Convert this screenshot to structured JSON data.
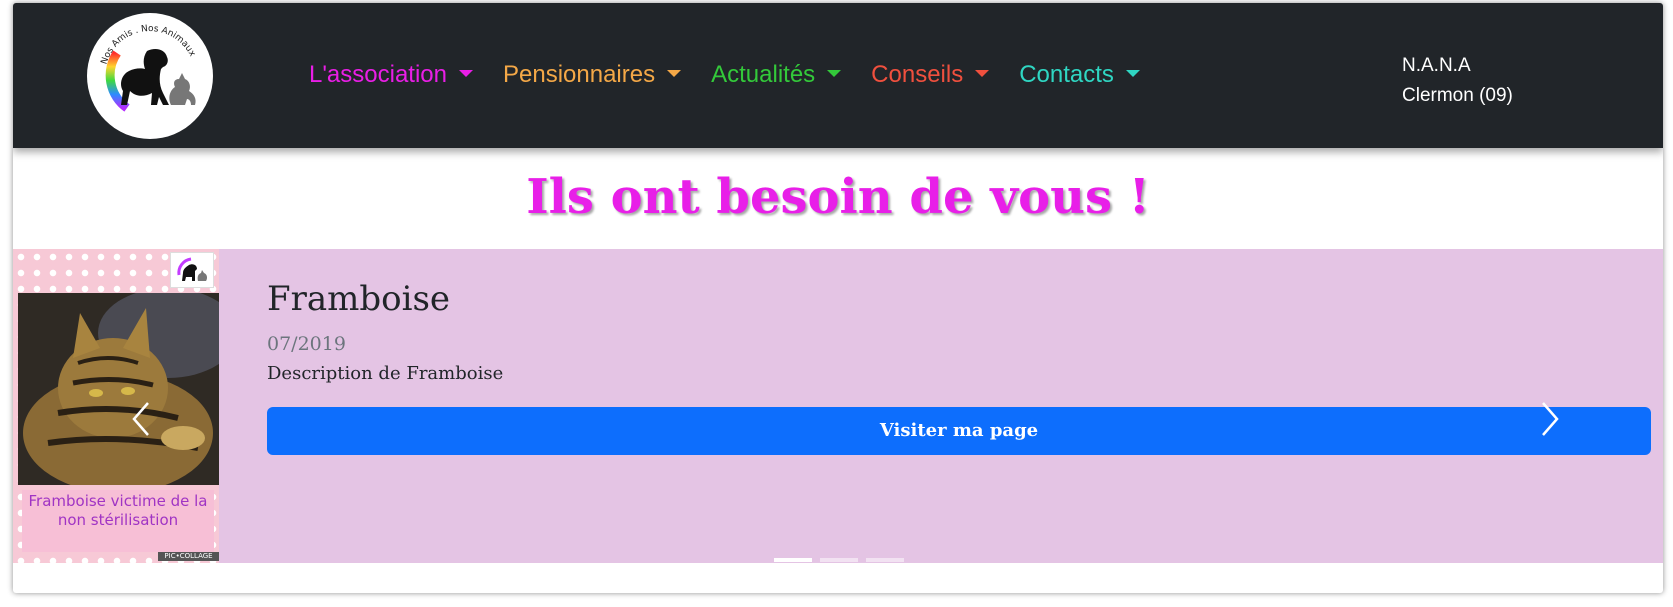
{
  "header": {
    "nav": [
      {
        "label": "L'association",
        "color": "#e91ee6"
      },
      {
        "label": "Pensionnaires",
        "color": "#f4a847"
      },
      {
        "label": "Actualités",
        "color": "#33c93a"
      },
      {
        "label": "Conseils",
        "color": "#f0503e"
      },
      {
        "label": "Contacts",
        "color": "#2fd6c2"
      }
    ],
    "brand_line1": "N.A.N.A",
    "brand_line2": "Clermon (09)",
    "logo_text": "Nos Amis . Nos Animaux"
  },
  "headline": {
    "text": "Ils ont besoin de vous !",
    "color": "#e81fe8"
  },
  "carousel": {
    "background": "#e4c4e4",
    "slide": {
      "name": "Framboise",
      "date": "07/2019",
      "description": "Description de Framboise",
      "button_label": "Visiter ma page",
      "image_caption": "Framboise victime de la non stérilisation",
      "image_tag": "PIC•COLLAGE"
    },
    "indicator_count": 3,
    "active_indicator": 1
  },
  "icons": [
    "chevron-left-icon",
    "chevron-right-icon",
    "caret-down-icon",
    "logo-dog-cat-icon"
  ]
}
